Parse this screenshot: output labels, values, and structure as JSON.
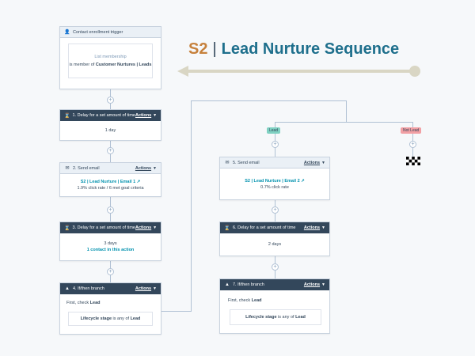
{
  "title": {
    "prefix": "S2",
    "separator": "|",
    "text": "Lead Nurture Sequence",
    "prefix_color": "#c6813c",
    "text_color": "#1e6f8c",
    "arrow_color": "#d9d6c4"
  },
  "trigger": {
    "header": "Contact enrollment trigger",
    "icon": "person-icon",
    "list_label": "List membership",
    "condition_prefix": "is member of",
    "list_name": "Customer Nurtures | Leads"
  },
  "step1": {
    "header": "1. Delay for a set amount of time",
    "actions": "Actions",
    "value": "1 day"
  },
  "step2": {
    "header": "2. Send email",
    "actions": "Actions",
    "email": "S2 | Lead Nurture | Email 1",
    "stats": "1.9% click rate / 6 met goal criteria"
  },
  "step3": {
    "header": "3. Delay for a set amount of time",
    "actions": "Actions",
    "value": "3 days",
    "contacts": "1 contact in this action"
  },
  "step4": {
    "header": "4. If/then branch",
    "actions": "Actions",
    "check_prefix": "First, check",
    "check_value": "Lead",
    "criteria_field": "Lifecycle stage",
    "criteria_op": "is any of",
    "criteria_value": "Lead"
  },
  "branches": {
    "lead": "Lead",
    "not_lead": "Not Lead",
    "lead_color": "#7fd1c2",
    "not_lead_color": "#f2a0a4"
  },
  "step5": {
    "header": "5. Send email",
    "actions": "Actions",
    "email": "S2 | Lead Nurture | Email 2",
    "stats": "0.7% click rate"
  },
  "step6": {
    "header": "6. Delay for a set amount of time",
    "actions": "Actions",
    "value": "2 days"
  },
  "step7": {
    "header": "7. If/then branch",
    "actions": "Actions",
    "check_prefix": "First, check",
    "check_value": "Lead",
    "criteria_field": "Lifecycle stage",
    "criteria_op": "is any of",
    "criteria_value": "Lead"
  }
}
